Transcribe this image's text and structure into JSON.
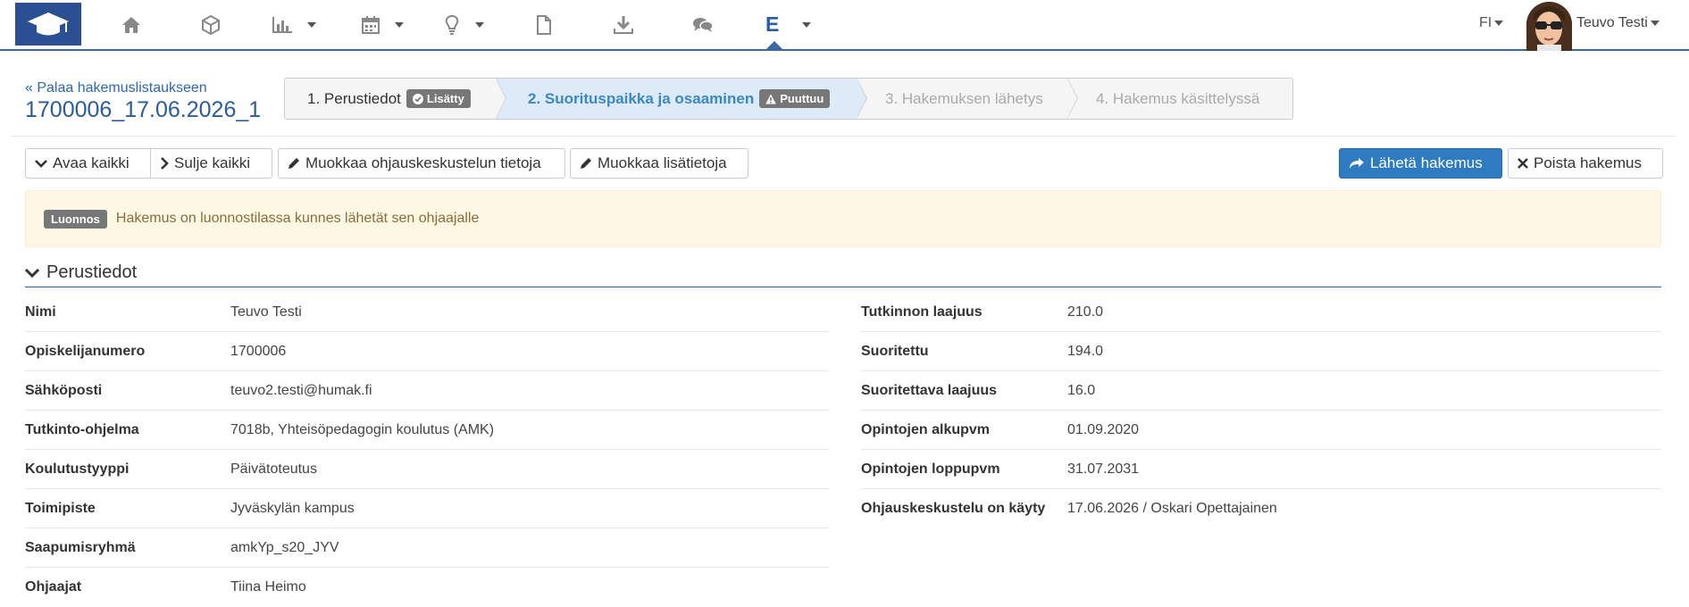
{
  "nav": {
    "items": [
      {
        "name": "home-icon"
      },
      {
        "name": "cube-icon"
      },
      {
        "name": "bar-chart-icon"
      },
      {
        "name": "calendar-icon"
      },
      {
        "name": "lightbulb-icon"
      },
      {
        "name": "file-icon"
      },
      {
        "name": "download-icon"
      },
      {
        "name": "comments-icon"
      }
    ],
    "active_label": "E",
    "lang": "FI",
    "user": "Teuvo Testi"
  },
  "header": {
    "back_link": "« Palaa hakemuslistaukseen",
    "title": "1700006_17.06.2026_1"
  },
  "wizard": {
    "steps": [
      {
        "label": "1. Perustiedot",
        "badge": "Lisätty"
      },
      {
        "label": "2. Suorituspaikka ja osaaminen",
        "badge": "Puuttuu"
      },
      {
        "label": "3. Hakemuksen lähetys"
      },
      {
        "label": "4. Hakemus käsittelyssä"
      }
    ]
  },
  "toolbar": {
    "open_all": "Avaa kaikki",
    "close_all": "Sulje kaikki",
    "edit_guidance": "Muokkaa ohjauskeskustelun tietoja",
    "edit_extra": "Muokkaa lisätietoja",
    "send": "Lähetä hakemus",
    "delete": "Poista hakemus"
  },
  "alert": {
    "badge": "Luonnos",
    "text": "Hakemus on luonnostilassa kunnes lähetät sen ohjaajalle"
  },
  "section": {
    "title": "Perustiedot",
    "left": [
      {
        "label": "Nimi",
        "value": "Teuvo Testi"
      },
      {
        "label": "Opiskelijanumero",
        "value": "1700006"
      },
      {
        "label": "Sähköposti",
        "value": "teuvo2.testi@humak.fi"
      },
      {
        "label": "Tutkinto-ohjelma",
        "value": "7018b, Yhteisöpedagogin koulutus (AMK)"
      },
      {
        "label": "Koulutustyyppi",
        "value": "Päivätoteutus"
      },
      {
        "label": "Toimipiste",
        "value": "Jyväskylän kampus"
      },
      {
        "label": "Saapumisryhmä",
        "value": "amkYp_s20_JYV"
      },
      {
        "label": "Ohjaajat",
        "value": "Tiina Heimo"
      }
    ],
    "right": [
      {
        "label": "Tutkinnon laajuus",
        "value": "210.0"
      },
      {
        "label": "Suoritettu",
        "value": "194.0"
      },
      {
        "label": "Suoritettava laajuus",
        "value": "16.0"
      },
      {
        "label": "Opintojen alkupvm",
        "value": "01.09.2020"
      },
      {
        "label": "Opintojen loppupvm",
        "value": "31.07.2031"
      },
      {
        "label": "Ohjauskeskustelu on käyty",
        "value": "17.06.2026 / Oskari Opettajainen"
      }
    ]
  },
  "colors": {
    "brand": "#2b4f93",
    "primary": "#2f7bc2",
    "active_step": "#dcebf7",
    "warning_bg": "#fcf8e3"
  }
}
